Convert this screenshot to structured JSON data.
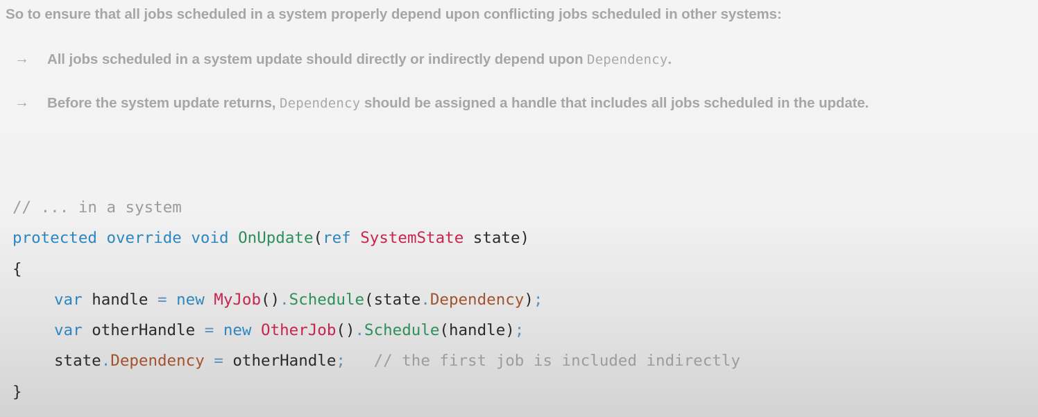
{
  "intro": "So to ensure that all jobs scheduled in a system properly depend upon conflicting jobs scheduled in other systems:",
  "bullets": [
    {
      "arrow": "→",
      "before": "All jobs scheduled in a system update should directly or indirectly depend upon ",
      "code": "Dependency",
      "after": "."
    },
    {
      "arrow": "→",
      "before": "Before the system update returns, ",
      "code": "Dependency",
      "after": " should be assigned a handle that includes all jobs scheduled in the update."
    }
  ],
  "code": {
    "comment_line": "// ... in a system",
    "signature": {
      "protected": "protected",
      "override": "override",
      "void": "void",
      "method": "OnUpdate",
      "open_paren": "(",
      "ref": "ref",
      "type": "SystemState",
      "param": "state",
      "close_paren": ")"
    },
    "open_brace": "{",
    "line1": {
      "var": "var",
      "name": "handle",
      "eq": "=",
      "new": "new",
      "type": "MyJob",
      "call": "()",
      "dot": ".",
      "method": "Schedule",
      "arg_open": "(state",
      "arg_dot": ".",
      "prop": "Dependency",
      "arg_close": ")",
      "semi": ";"
    },
    "line2": {
      "var": "var",
      "name": "otherHandle",
      "eq": "=",
      "new": "new",
      "type": "OtherJob",
      "call": "()",
      "dot": ".",
      "method": "Schedule",
      "args": "(handle)",
      "semi": ";"
    },
    "line3": {
      "obj": "state",
      "dot": ".",
      "prop": "Dependency",
      "eq": "=",
      "value": "otherHandle",
      "semi": ";",
      "comment": "// the first job is included indirectly"
    },
    "close_brace": "}"
  },
  "colors": {
    "keyword": "#2e86c1",
    "function": "#2d8f5a",
    "type": "#c7254e",
    "property": "#a3522e",
    "comment": "#9c9c9c",
    "prose": "#a6a6a6"
  }
}
